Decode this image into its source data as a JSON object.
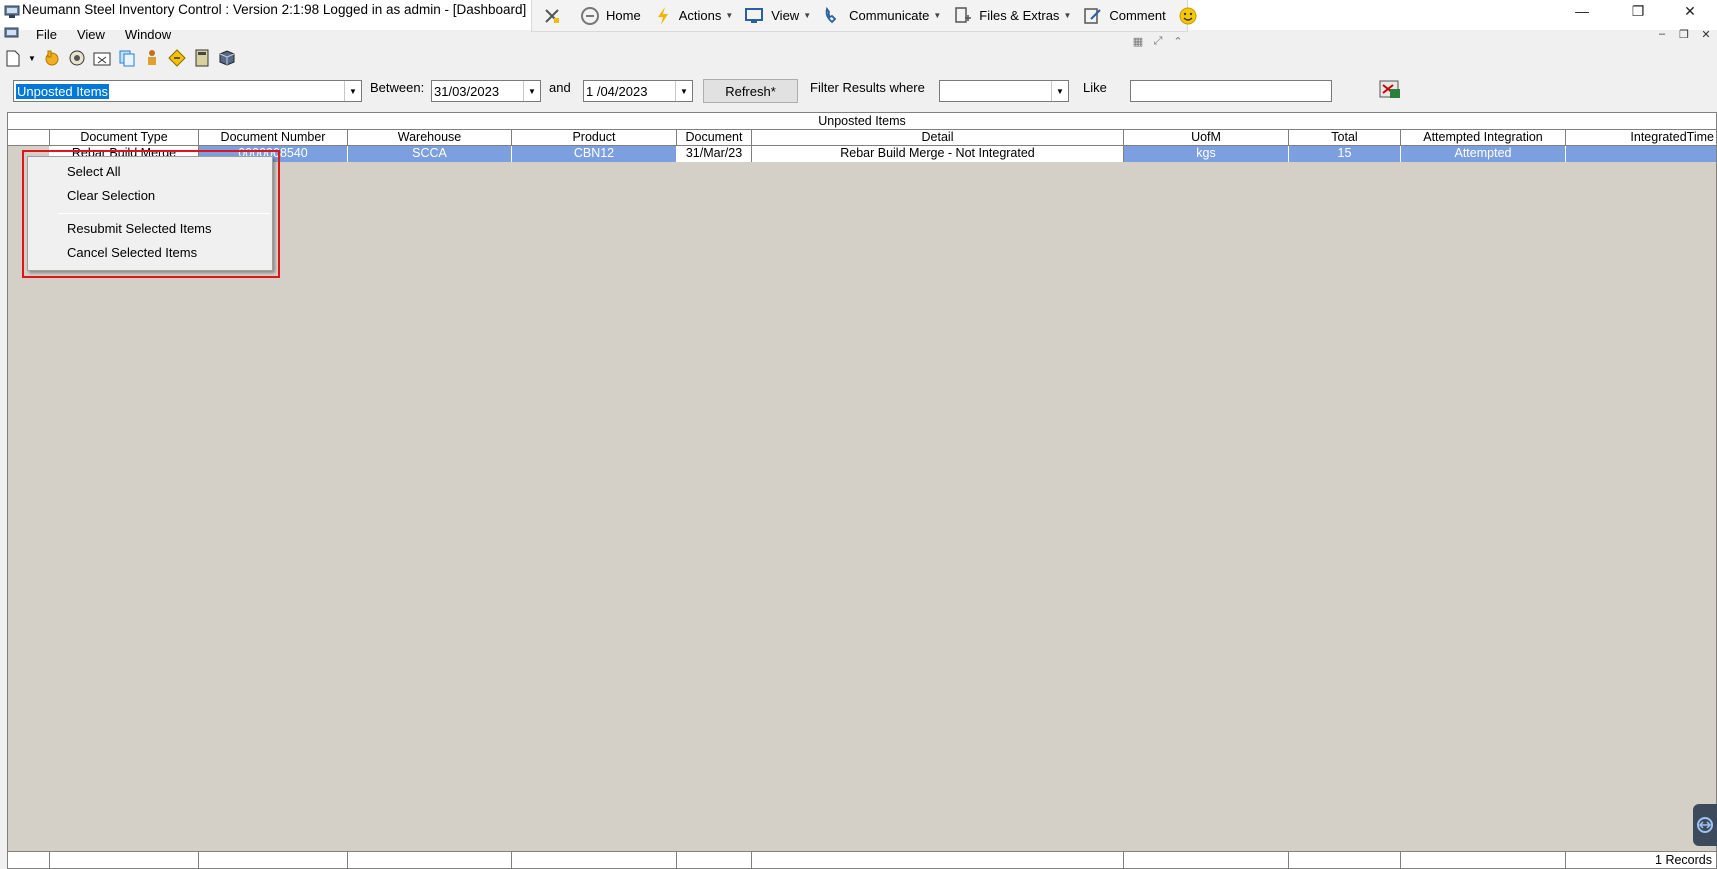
{
  "window": {
    "title": "Neumann Steel Inventory Control : Version 2:1:98 Logged in as admin - [Dashboard]"
  },
  "topbar": {
    "items": [
      {
        "label": "",
        "icon": "tools-icon"
      },
      {
        "label": "Home",
        "icon": "home-icon"
      },
      {
        "label": "Actions",
        "icon": "lightning-icon",
        "dropdown": true
      },
      {
        "label": "View",
        "icon": "monitor-icon",
        "dropdown": true
      },
      {
        "label": "Communicate",
        "icon": "phone-icon",
        "dropdown": true
      },
      {
        "label": "Files & Extras",
        "icon": "files-icon",
        "dropdown": true
      },
      {
        "label": "Comment",
        "icon": "comment-icon"
      },
      {
        "label": "",
        "icon": "smiley-icon"
      }
    ]
  },
  "menubar": {
    "items": [
      "File",
      "View",
      "Window"
    ]
  },
  "filter": {
    "report_value": "Unposted Items",
    "between_label": "Between:",
    "date_from": "31/03/2023",
    "and_label": "and",
    "date_to": "1 /04/2023",
    "refresh_label": "Refresh*",
    "filter_where_label": "Filter Results where",
    "filter_field_value": "",
    "like_label": "Like",
    "like_value": ""
  },
  "grid": {
    "caption": "Unposted Items",
    "columns": [
      "",
      "Document Type",
      "Document Number",
      "Warehouse",
      "Product",
      "Document",
      "Detail",
      "UofM",
      "Total",
      "Attempted Integration",
      "IntegratedTime"
    ],
    "rows": [
      [
        "",
        "Rebar Build Merge",
        "0000008540",
        "SCCA",
        "CBN12",
        "31/Mar/23",
        "Rebar Build Merge - Not Integrated",
        "kgs",
        "15",
        "Attempted",
        ""
      ]
    ],
    "records_label": "1 Records"
  },
  "context_menu": {
    "items": [
      "Select All",
      "Clear Selection",
      "Resubmit Selected Items",
      "Cancel Selected Items"
    ]
  },
  "colors": {
    "selection": "#7b9fdf",
    "highlight_border": "#e0141b",
    "grid_background": "#d4d0c8"
  }
}
